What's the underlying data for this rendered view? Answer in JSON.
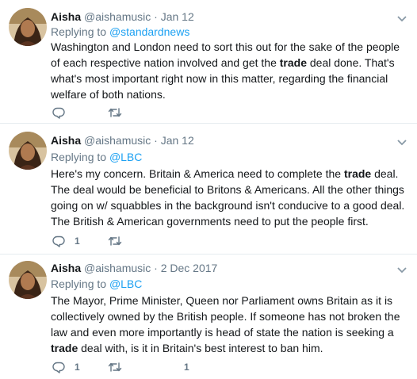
{
  "tweets": [
    {
      "name": "Aisha",
      "handle": "@aishamusic",
      "separator": "·",
      "date": "Jan 12",
      "replying_prefix": "Replying to",
      "replying_to": "@standardnews",
      "text_before": "Washington and London need to sort this out for the sake of the people of each respective nation involved and get the ",
      "keyword": "trade",
      "text_after": " deal done. That's what's most important right now in this matter, regarding the financial welfare of both nations.",
      "reply_count": "",
      "retweet_count": "",
      "like_count": ""
    },
    {
      "name": "Aisha",
      "handle": "@aishamusic",
      "separator": "·",
      "date": "Jan 12",
      "replying_prefix": "Replying to",
      "replying_to": "@LBC",
      "text_before": "Here's my concern. Britain & America need to complete the ",
      "keyword": "trade",
      "text_after": " deal. The deal would be beneficial to Britons & Americans. All the other things going on w/ squabbles in the background isn't conducive to a good deal. The British & American governments need to put the people first.",
      "reply_count": "1",
      "retweet_count": "",
      "like_count": ""
    },
    {
      "name": "Aisha",
      "handle": "@aishamusic",
      "separator": "·",
      "date": "2 Dec 2017",
      "replying_prefix": "Replying to",
      "replying_to": "@LBC",
      "text_before": "The Mayor, Prime Minister, Queen nor Parliament owns Britain as it is collectively owned by the British people. If someone has not broken the law and even more importantly is head of state the nation is seeking a ",
      "keyword": "trade",
      "text_after": " deal with, is it in Britain's best interest to ban him.",
      "reply_count": "1",
      "retweet_count": "",
      "like_count": "1"
    }
  ],
  "icons": {
    "reply": "reply-icon",
    "retweet": "retweet-icon",
    "caret": "chevron-down-icon",
    "avatar": "avatar"
  },
  "colors": {
    "link": "#1da1f2",
    "secondary_text": "#657786",
    "divider": "#e6ecf0"
  }
}
